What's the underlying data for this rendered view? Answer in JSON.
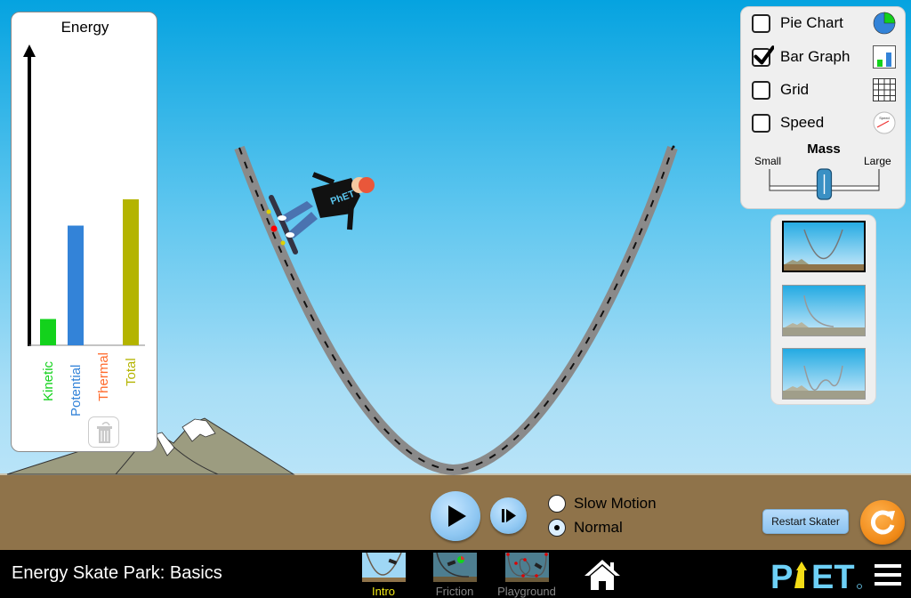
{
  "app": {
    "title": "Energy Skate Park: Basics"
  },
  "energy_chart": {
    "title": "Energy",
    "chart_data": {
      "type": "bar",
      "title": "Energy",
      "categories": [
        "Kinetic",
        "Potential",
        "Thermal",
        "Total"
      ],
      "values": [
        0.09,
        0.41,
        0,
        0.5
      ],
      "value_scale": "fraction of axis height",
      "colors": [
        "#13d21c",
        "#3383d8",
        "#ff6a2b",
        "#b4b400"
      ],
      "ylabel": "",
      "xlabel": "",
      "grid": false,
      "legend": "none"
    },
    "trash_icon": "trash-icon"
  },
  "controls": {
    "checkboxes": [
      {
        "label": "Pie Chart",
        "checked": false,
        "icon": "pie-chart-icon"
      },
      {
        "label": "Bar Graph",
        "checked": true,
        "icon": "bar-graph-icon"
      },
      {
        "label": "Grid",
        "checked": false,
        "icon": "grid-icon"
      },
      {
        "label": "Speed",
        "checked": false,
        "icon": "speedometer-icon"
      }
    ],
    "mass": {
      "title": "Mass",
      "min_label": "Small",
      "max_label": "Large",
      "value_fraction": 0.5
    }
  },
  "track_selector": {
    "tracks": [
      {
        "name": "parabola",
        "selected": true
      },
      {
        "name": "slope",
        "selected": false
      },
      {
        "name": "double-well",
        "selected": false
      }
    ]
  },
  "playback": {
    "play_icon": "play-icon",
    "step_icon": "step-forward-icon",
    "speed_options": [
      {
        "label": "Slow Motion",
        "selected": false
      },
      {
        "label": "Normal",
        "selected": true
      }
    ]
  },
  "restart_skater_label": "Restart Skater",
  "navbar": {
    "screens": [
      {
        "label": "Intro",
        "active": true
      },
      {
        "label": "Friction",
        "active": false
      },
      {
        "label": "Playground",
        "active": false
      }
    ],
    "logo_text": "PhET"
  },
  "colors": {
    "ground": "#8f734a",
    "sky_top": "#05a3e0",
    "sky_bottom": "#d0ecfb",
    "track": "#8a8a8a",
    "button_blue": "#8fc7f2",
    "reset_orange": "#f08a18",
    "active_tab": "#f2e916"
  }
}
